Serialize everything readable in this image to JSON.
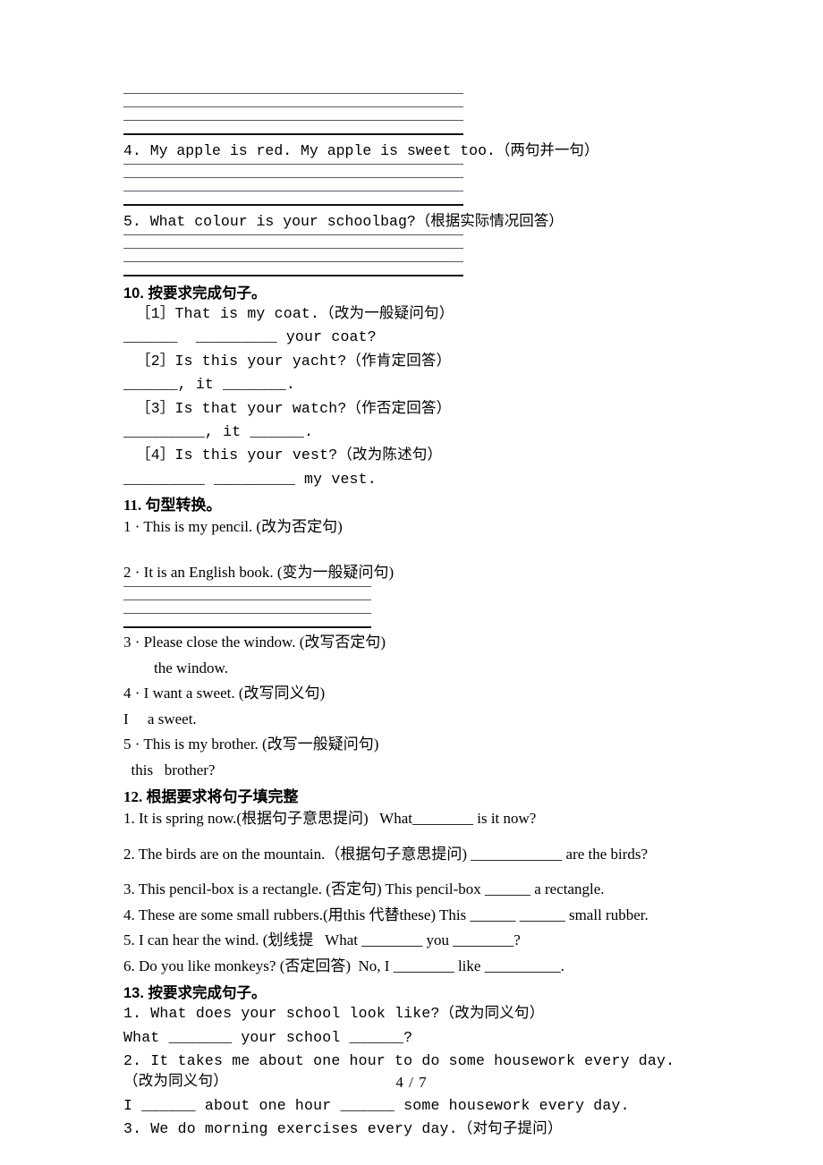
{
  "document": {
    "page_label": "4 / 7",
    "top_answer_lines": {
      "count": 4
    },
    "items_top": [
      {
        "id": "q4",
        "text": "4. My apple is red. My apple is sweet too.（两句并一句）",
        "answer_lines": 4
      },
      {
        "id": "q5",
        "text": "5. What colour is your schoolbag?（根据实际情况回答）",
        "answer_lines": 4
      }
    ],
    "sections": [
      {
        "id": "sec10",
        "number": "10.",
        "title": "10.  按要求完成句子。",
        "style": "mono",
        "items": [
          {
            "prompt": "［1］That is my coat.（改为一般疑问句）",
            "answer": "______  _________ your coat?"
          },
          {
            "prompt": "［2］Is this your yacht?（作肯定回答）",
            "answer": "______, it _______."
          },
          {
            "prompt": "［3］Is that your watch?（作否定回答）",
            "answer": "_________, it ______."
          },
          {
            "prompt": "［4］Is this your vest?（改为陈述句）",
            "answer": "_________ _________ my vest."
          }
        ]
      },
      {
        "id": "sec11",
        "number": "11.",
        "title": "11. 句型转换。",
        "style": "serif",
        "items": [
          {
            "prompt": "1 · This is my pencil. (改为否定句)",
            "answer": "",
            "blank_gap": true
          },
          {
            "prompt": "2 · It is an English book. (变为一般疑问句)",
            "answer": "",
            "answer_lines": 4
          },
          {
            "prompt": "3 · Please close the window. (改写否定句)",
            "answer": "        the window."
          },
          {
            "prompt": "4 · I want a sweet. (改写同义句)",
            "answer": "I     a sweet."
          },
          {
            "prompt": "5 · This is my brother. (改写一般疑问句)",
            "answer": "  this   brother?"
          }
        ]
      },
      {
        "id": "sec12",
        "number": "12.",
        "title": "12. 根据要求将句子填完整",
        "style": "serif",
        "items": [
          {
            "prompt": "1. It is spring now.(根据句子意思提问)   What________ is it now?"
          },
          {
            "prompt": "2. The birds are on the mountain.（根据句子意思提问) ____________ are the birds?"
          },
          {
            "prompt": "3. This pencil-box is a rectangle. (否定句) This pencil-box ______ a rectangle."
          },
          {
            "prompt": "4. These are some small rubbers.(用this 代替these) This ______ ______ small rubber."
          },
          {
            "prompt": "5. I can hear the wind. (划线提   What ________ you ________?"
          },
          {
            "prompt": "6. Do you like monkeys? (否定回答)  No, I ________ like __________."
          }
        ]
      },
      {
        "id": "sec13",
        "number": "13.",
        "title": "13.  按要求完成句子。",
        "style": "mono",
        "items": [
          {
            "prompt": "1. What does your school look like?（改为同义句）",
            "answer": "What _______ your school ______?"
          },
          {
            "prompt": "2. It takes me about one hour to do some housework every day.\n（改为同义句）",
            "answer": "I ______ about one hour ______ some housework every day."
          },
          {
            "prompt": "3. We do morning exercises every day.（对句子提问）",
            "answer": ""
          }
        ]
      }
    ]
  }
}
